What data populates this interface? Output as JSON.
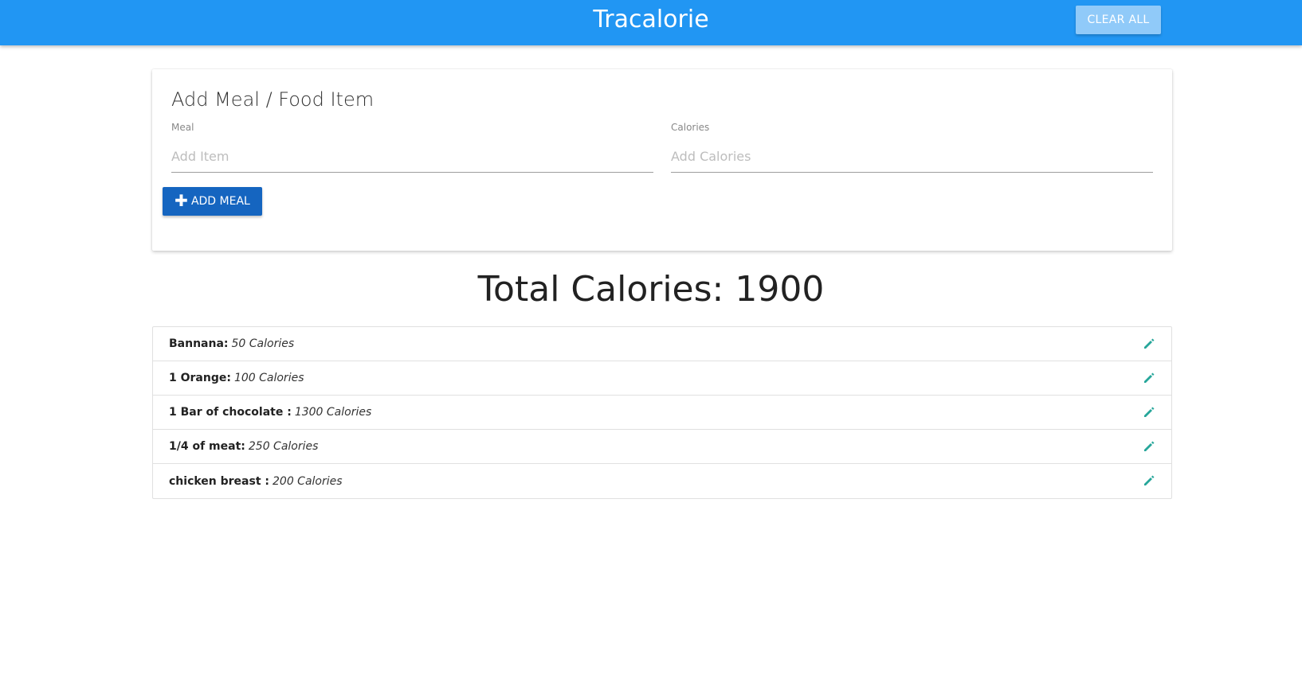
{
  "navbar": {
    "brand": "Tracalorie",
    "clear_all_label": "CLEAR ALL"
  },
  "form": {
    "title": "Add Meal / Food Item",
    "meal_label": "Meal",
    "meal_placeholder": "Add Item",
    "calories_label": "Calories",
    "calories_placeholder": "Add Calories",
    "add_button_label": "ADD MEAL",
    "add_button_icon": "plus-icon"
  },
  "total": {
    "text": "Total Calories: 1900"
  },
  "items": [
    {
      "name": "Bannana:",
      "calories": "50 Calories",
      "icon": "pencil-icon"
    },
    {
      "name": "1 Orange:",
      "calories": "100 Calories",
      "icon": "pencil-icon"
    },
    {
      "name": "1 Bar of chocolate :",
      "calories": "1300 Calories",
      "icon": "pencil-icon"
    },
    {
      "name": "1/4 of meat:",
      "calories": "250 Calories",
      "icon": "pencil-icon"
    },
    {
      "name": "chicken breast :",
      "calories": "200 Calories",
      "icon": "pencil-icon"
    }
  ],
  "colors": {
    "navbar": "#2196f3",
    "clear_button": "#90caf9",
    "add_button": "#1565c0",
    "edit_icon": "#26a69a"
  }
}
